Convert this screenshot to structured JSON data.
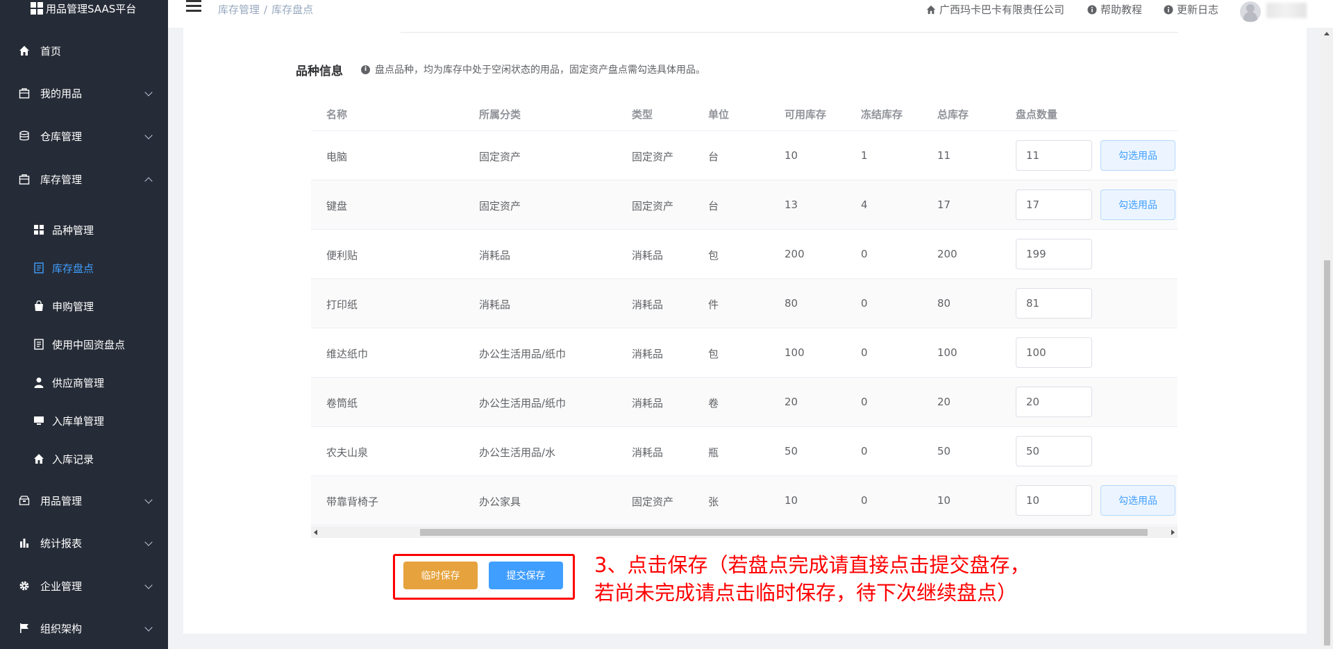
{
  "app": {
    "title": "用品管理SAAS平台"
  },
  "sidebar": {
    "items": [
      {
        "label": "首页",
        "icon": "home-icon"
      },
      {
        "label": "我的用品",
        "icon": "bag-icon"
      },
      {
        "label": "仓库管理",
        "icon": "database-icon"
      },
      {
        "label": "库存管理",
        "icon": "bag-icon"
      },
      {
        "label": "用品管理",
        "icon": "box-icon"
      },
      {
        "label": "统计报表",
        "icon": "bar-chart-icon"
      },
      {
        "label": "企业管理",
        "icon": "gear-icon"
      },
      {
        "label": "组织架构",
        "icon": "flag-icon"
      }
    ],
    "subitems": [
      {
        "label": "品种管理",
        "icon": "grid-icon"
      },
      {
        "label": "库存盘点",
        "icon": "document-icon",
        "active": true
      },
      {
        "label": "申购管理",
        "icon": "shopping-bag-icon"
      },
      {
        "label": "使用中固资盘点",
        "icon": "document-icon"
      },
      {
        "label": "供应商管理",
        "icon": "user-icon"
      },
      {
        "label": "入库单管理",
        "icon": "monitor-icon"
      },
      {
        "label": "入库记录",
        "icon": "home-icon"
      }
    ]
  },
  "header": {
    "breadcrumb": [
      "库存管理",
      "库存盘点"
    ],
    "breadcrumb_sep": "/",
    "company": "广西玛卡巴卡有限责任公司",
    "help": "帮助教程",
    "changelog": "更新日志"
  },
  "section": {
    "title": "品种信息",
    "tip": "盘点品种，均为库存中处于空闲状态的用品，固定资产盘点需勾选具体用品。"
  },
  "table": {
    "columns": [
      "名称",
      "所属分类",
      "类型",
      "单位",
      "可用库存",
      "冻结库存",
      "总库存",
      "盘点数量"
    ],
    "rows": [
      {
        "name": "电脑",
        "category": "固定资产",
        "type": "固定资产",
        "unit": "台",
        "available": "10",
        "frozen": "1",
        "total": "11",
        "count": "11",
        "pick": "勾选用品"
      },
      {
        "name": "键盘",
        "category": "固定资产",
        "type": "固定资产",
        "unit": "台",
        "available": "13",
        "frozen": "4",
        "total": "17",
        "count": "17",
        "pick": "勾选用品"
      },
      {
        "name": "便利贴",
        "category": "消耗品",
        "type": "消耗品",
        "unit": "包",
        "available": "200",
        "frozen": "0",
        "total": "200",
        "count": "199"
      },
      {
        "name": "打印纸",
        "category": "消耗品",
        "type": "消耗品",
        "unit": "件",
        "available": "80",
        "frozen": "0",
        "total": "80",
        "count": "81"
      },
      {
        "name": "维达纸巾",
        "category": "办公生活用品/纸巾",
        "type": "消耗品",
        "unit": "包",
        "available": "100",
        "frozen": "0",
        "total": "100",
        "count": "100"
      },
      {
        "name": "卷筒纸",
        "category": "办公生活用品/纸巾",
        "type": "消耗品",
        "unit": "卷",
        "available": "20",
        "frozen": "0",
        "total": "20",
        "count": "20"
      },
      {
        "name": "农夫山泉",
        "category": "办公生活用品/水",
        "type": "消耗品",
        "unit": "瓶",
        "available": "50",
        "frozen": "0",
        "total": "50",
        "count": "50"
      },
      {
        "name": "带靠背椅子",
        "category": "办公家具",
        "type": "固定资产",
        "unit": "张",
        "available": "10",
        "frozen": "0",
        "total": "10",
        "count": "10",
        "pick": "勾选用品"
      }
    ]
  },
  "actions": {
    "temp_save": "临时保存",
    "submit_save": "提交保存"
  },
  "annotation": {
    "line1": "3、点击保存（若盘点完成请直接点击提交盘存，",
    "line2": "若尚未完成请点击临时保存，待下次继续盘点）"
  },
  "colors": {
    "sidebar_bg": "#262c37",
    "accent": "#409eff",
    "warning": "#e6a23c",
    "annotation": "#ff0000"
  }
}
